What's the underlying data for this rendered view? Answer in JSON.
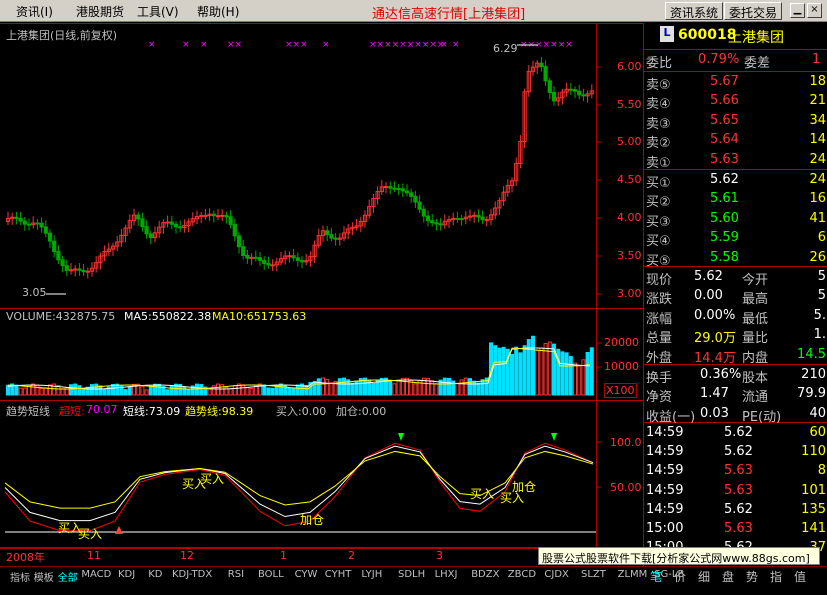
{
  "menu": {
    "items": [
      "资讯(I)",
      "港股期货",
      "工具(V)",
      "帮助(H)"
    ],
    "app_title": "通达信高速行情[上港集团]",
    "buttons": [
      "资讯系统",
      "委托交易"
    ]
  },
  "chart": {
    "title": "上港集团(日线,前复权)",
    "price_axis": [
      "6.00",
      "5.50",
      "5.00",
      "4.50",
      "4.00",
      "3.50",
      "3.00"
    ],
    "high_label": "6.29",
    "low_label": "3.05",
    "volume_legend": {
      "volume": "VOLUME:432875.75",
      "ma5": "MA5:550822.38",
      "ma10": "MA10:651753.63"
    },
    "volume_axis": [
      "20000",
      "10000"
    ],
    "volume_unit": "X100",
    "indicator_legend": {
      "name": "趋势短线",
      "chaoduan_label": "超短:",
      "chaoduan_value": "70.07",
      "duanxian": "短线:73.09",
      "qushi": "趋势线:98.39",
      "mairu": "买入:0.00",
      "jiacang": "加仓:0.00"
    },
    "indicator_axis": [
      "100.0",
      "50.00"
    ],
    "annotations": [
      "买入",
      "买入",
      "买入",
      "买入",
      "加仓",
      "买入",
      "加仓",
      "买入"
    ],
    "date_axis": [
      "2008年",
      "11",
      "12",
      "1",
      "2",
      "3"
    ],
    "colors": {
      "up": "#ff3232",
      "down": "#00a800",
      "white_line": "#ffffff",
      "yellow_line": "#ffff00",
      "magenta_line": "#ff00ff",
      "red_line": "#ff0000",
      "grid": "#b00000"
    }
  },
  "quote": {
    "code": "600018",
    "name": "上港集团",
    "weibi_label": "委比",
    "weibi_value": "0.79%",
    "weicha_label": "委差",
    "weicha_value": "1",
    "asks": [
      {
        "label": "卖⑤",
        "price": "5.67",
        "vol": "18"
      },
      {
        "label": "卖④",
        "price": "5.66",
        "vol": "21"
      },
      {
        "label": "卖③",
        "price": "5.65",
        "vol": "34"
      },
      {
        "label": "卖②",
        "price": "5.64",
        "vol": "14"
      },
      {
        "label": "卖①",
        "price": "5.63",
        "vol": "24"
      }
    ],
    "bids": [
      {
        "label": "买①",
        "price": "5.62",
        "vol": "24"
      },
      {
        "label": "买②",
        "price": "5.61",
        "vol": "16"
      },
      {
        "label": "买③",
        "price": "5.60",
        "vol": "41"
      },
      {
        "label": "买④",
        "price": "5.59",
        "vol": "6"
      },
      {
        "label": "买⑤",
        "price": "5.58",
        "vol": "26"
      }
    ],
    "stats": [
      {
        "l1": "现价",
        "v1": "5.62",
        "l2": "今开",
        "v2": "5"
      },
      {
        "l1": "涨跌",
        "v1": "0.00",
        "l2": "最高",
        "v2": "5"
      },
      {
        "l1": "涨幅",
        "v1": "0.00%",
        "l2": "最低",
        "v2": "5."
      },
      {
        "l1": "总量",
        "v1": "29.0万",
        "l2": "量比",
        "v2": "1."
      },
      {
        "l1": "外盘",
        "v1": "14.4万",
        "l2": "内盘",
        "v2": "14.5"
      }
    ],
    "stats2": [
      {
        "l1": "换手",
        "v1": "0.36%",
        "l2": "股本",
        "v2": "210"
      },
      {
        "l1": "净资",
        "v1": "1.47",
        "l2": "流通",
        "v2": "79.9"
      },
      {
        "l1": "收益(一)",
        "v1": "0.03",
        "l2": "PE(动)",
        "v2": "40"
      }
    ],
    "ticks": [
      {
        "time": "14:59",
        "price": "5.62",
        "vol": "60"
      },
      {
        "time": "14:59",
        "price": "5.62",
        "vol": "110"
      },
      {
        "time": "14:59",
        "price": "5.63",
        "vol": "8"
      },
      {
        "time": "14:59",
        "price": "5.63",
        "vol": "101"
      },
      {
        "time": "14:59",
        "price": "5.62",
        "vol": "135"
      },
      {
        "time": "15:00",
        "price": "5.63",
        "vol": "141"
      },
      {
        "time": "15:00",
        "price": "5.62",
        "vol": "37"
      }
    ]
  },
  "bottom": {
    "tabs": [
      "指标",
      "模板",
      "全部",
      "MACD",
      "KDJ",
      "KD",
      "KDJ-TDX",
      "RSI",
      "BOLL",
      "CYW",
      "CYHT",
      "LYJH",
      "SDLH",
      "LHXJ",
      "BDZX",
      "ZBCD",
      "CJDX",
      "SLZT",
      "ZLMM",
      "SG-LB"
    ],
    "right_tabs": [
      "笔",
      "价",
      "细",
      "盘",
      "势",
      "指",
      "值"
    ],
    "ad_text": "股票公式股票软件下载[分析家公式网www.88gs.com]"
  }
}
